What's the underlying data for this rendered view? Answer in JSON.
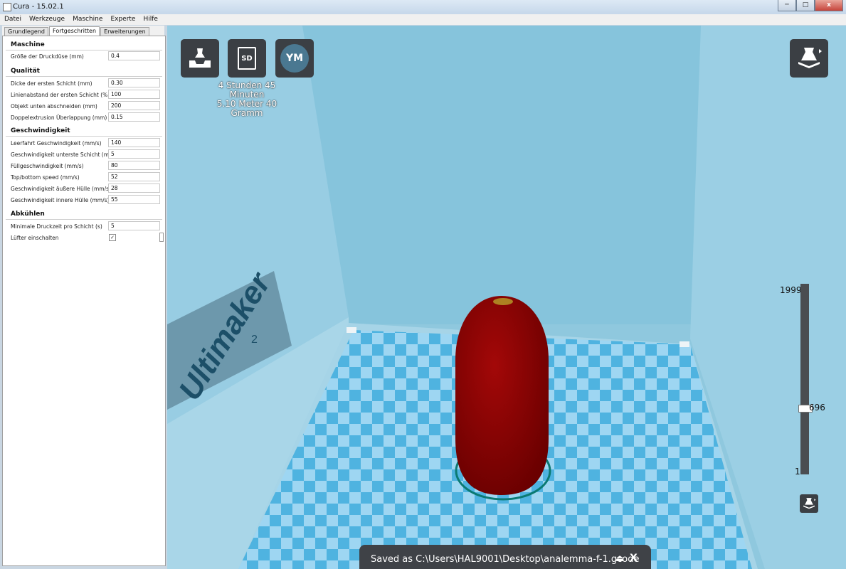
{
  "window": {
    "title": "Cura - 15.02.1",
    "controls": [
      "─",
      "□",
      "x"
    ]
  },
  "menu": [
    "Datei",
    "Werkzeuge",
    "Maschine",
    "Experte",
    "Hilfe"
  ],
  "tabs": [
    "Grundlegend",
    "Fortgeschritten",
    "Erweiterungen"
  ],
  "sections": {
    "maschine": {
      "title": "Maschine",
      "fields": [
        {
          "label": "Größe der Druckdüse (mm)",
          "value": "0.4"
        }
      ]
    },
    "qualitaet": {
      "title": "Qualität",
      "fields": [
        {
          "label": "Dicke der ersten Schicht (mm)",
          "value": "0.30"
        },
        {
          "label": "Linienabstand der ersten Schicht (%)",
          "value": "100"
        },
        {
          "label": "Objekt unten abschneiden (mm)",
          "value": "200"
        },
        {
          "label": "Doppelextrusion Überlappung (mm)",
          "value": "0.15"
        }
      ]
    },
    "geschwindigkeit": {
      "title": "Geschwindigkeit",
      "fields": [
        {
          "label": "Leerfahrt Geschwindigkeit (mm/s)",
          "value": "140"
        },
        {
          "label": "Geschwindigkeit unterste Schicht (mm/s)",
          "value": "5"
        },
        {
          "label": "Füllgeschwindigkeit (mm/s)",
          "value": "80"
        },
        {
          "label": "Top/bottom speed (mm/s)",
          "value": "52"
        },
        {
          "label": "Geschwindigkeit äußere Hülle (mm/s)",
          "value": "28"
        },
        {
          "label": "Geschwindigkeit innere Hülle (mm/s)",
          "value": "55"
        }
      ]
    },
    "abkuehlen": {
      "title": "Abkühlen",
      "fields": [
        {
          "label": "Minimale Druckzeit pro Schicht (s)",
          "value": "5"
        },
        {
          "label": "Lüfter einschalten",
          "checked": true,
          "mark": "✓"
        }
      ]
    }
  },
  "viewport": {
    "buttons": {
      "load": "load-model-icon",
      "sd": "SD",
      "ym": "YM",
      "view_mode": "view-mode-icon"
    },
    "print_time": "4 Stunden 45 Minuten",
    "print_material": "5.10 Meter 40 Gramm",
    "brand": "Ultimaker",
    "brand_sup": "2",
    "layer_slider": {
      "max_label": "1999",
      "current_label": "696",
      "min_label": "1",
      "max": 1999,
      "current": 696,
      "min": 1
    },
    "save_message": "Saved as C:\\Users\\HAL9001\\Desktop\\analemma-f-1.gcode",
    "save_icon": "⏏",
    "save_close": "X"
  },
  "colors": {
    "model": "#8e0000",
    "bed_light": "#9ed6f2",
    "bed_dark": "#4fb3e0",
    "walls": "#8fc8de",
    "accent": "#3b3f44"
  }
}
